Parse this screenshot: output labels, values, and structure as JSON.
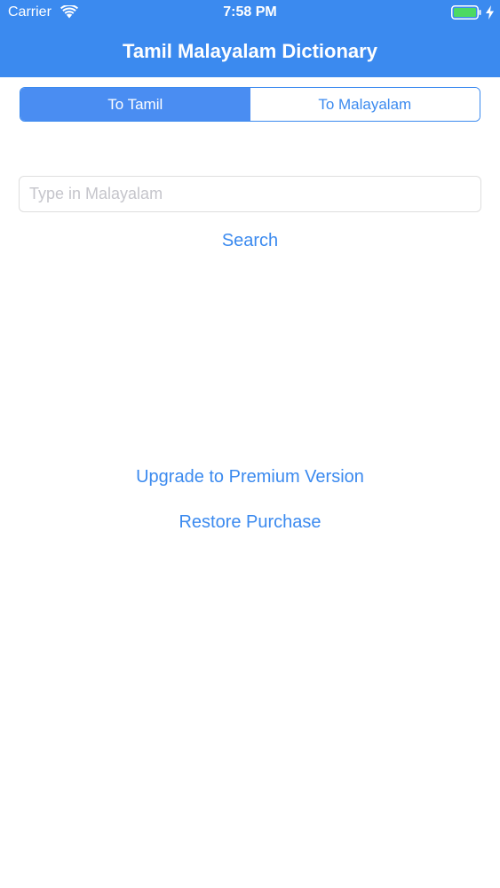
{
  "status_bar": {
    "carrier": "Carrier",
    "time": "7:58 PM",
    "wifi_icon": "wifi-icon",
    "battery_icon": "battery-icon",
    "battery_color": "#4cd964",
    "charging_icon": "charging-bolt-icon"
  },
  "nav": {
    "title": "Tamil Malayalam Dictionary",
    "background_color": "#3b8aef"
  },
  "segmented_control": {
    "options": [
      {
        "label": "To Tamil",
        "selected": true
      },
      {
        "label": "To Malayalam",
        "selected": false
      }
    ]
  },
  "search": {
    "value": "",
    "placeholder": "Type in Malayalam",
    "button_label": "Search"
  },
  "purchase": {
    "upgrade_label": "Upgrade to Premium Version",
    "restore_label": "Restore Purchase"
  },
  "colors": {
    "accent": "#3b8aef"
  }
}
